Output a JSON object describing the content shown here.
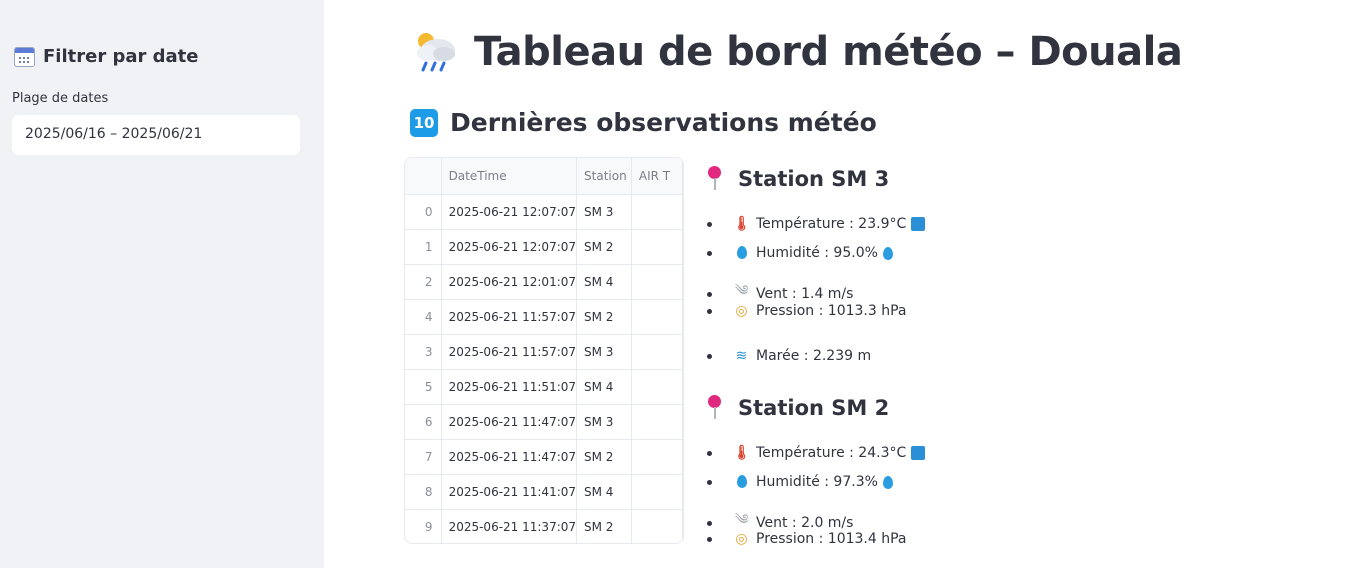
{
  "sidebar": {
    "title": "Filtrer par date",
    "date_label": "Plage de dates",
    "date_value": "2025/06/16 – 2025/06/21"
  },
  "main": {
    "title": "Tableau de bord météo – Douala",
    "section_title": "Dernières observations météo",
    "section_badge": "10"
  },
  "table": {
    "columns": [
      "",
      "DateTime",
      "Station",
      "AIR T"
    ],
    "rows": [
      {
        "idx": "0",
        "datetime": "2025-06-21 12:07:07",
        "station": "SM 3"
      },
      {
        "idx": "1",
        "datetime": "2025-06-21 12:07:07",
        "station": "SM 2"
      },
      {
        "idx": "2",
        "datetime": "2025-06-21 12:01:07",
        "station": "SM 4"
      },
      {
        "idx": "4",
        "datetime": "2025-06-21 11:57:07",
        "station": "SM 2"
      },
      {
        "idx": "3",
        "datetime": "2025-06-21 11:57:07",
        "station": "SM 3"
      },
      {
        "idx": "5",
        "datetime": "2025-06-21 11:51:07",
        "station": "SM 4"
      },
      {
        "idx": "6",
        "datetime": "2025-06-21 11:47:07",
        "station": "SM 3"
      },
      {
        "idx": "7",
        "datetime": "2025-06-21 11:47:07",
        "station": "SM 2"
      },
      {
        "idx": "8",
        "datetime": "2025-06-21 11:41:07",
        "station": "SM 4"
      },
      {
        "idx": "9",
        "datetime": "2025-06-21 11:37:07",
        "station": "SM 2"
      }
    ]
  },
  "stations": [
    {
      "title": "Station SM 3",
      "temperature": "Température : 23.9°C",
      "humidity": "Humidité : 95.0%",
      "wind": "Vent : 1.4 m/s",
      "pressure": "Pression : 1013.3 hPa",
      "tide": "Marée : 2.239 m"
    },
    {
      "title": "Station SM 2",
      "temperature": "Température : 24.3°C",
      "humidity": "Humidité : 97.3%",
      "wind": "Vent : 2.0 m/s",
      "pressure": "Pression : 1013.4 hPa"
    }
  ],
  "colors": {
    "sidebar_bg": "#f0f2f6",
    "text": "#31333f",
    "pin": "#e0287e",
    "badge": "#1e9be6"
  }
}
